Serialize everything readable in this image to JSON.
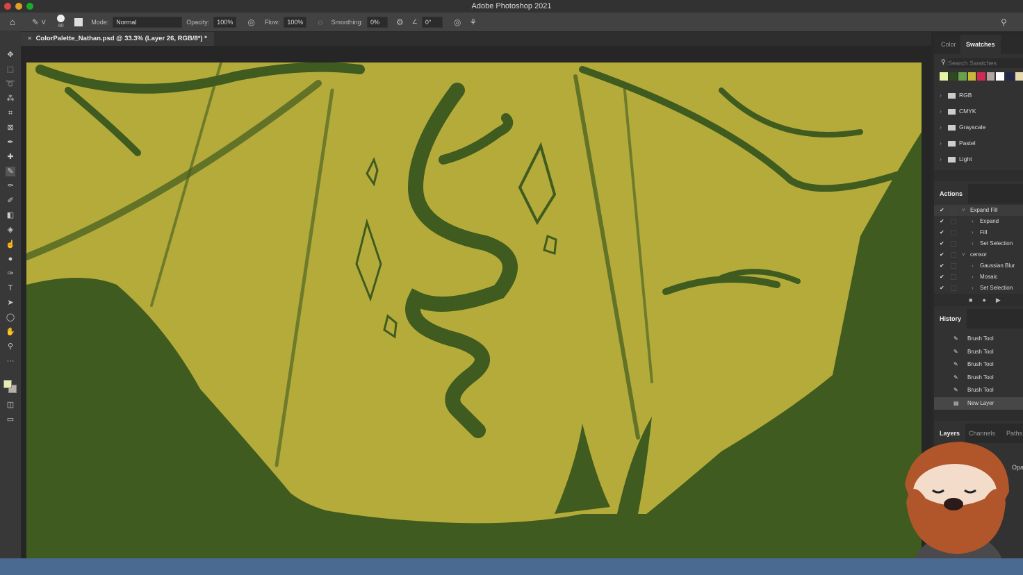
{
  "app_title": "Adobe Photoshop 2021",
  "options": {
    "brush_size": "80",
    "mode_label": "Mode:",
    "mode_value": "Normal",
    "opacity_label": "Opacity:",
    "opacity_value": "100%",
    "flow_label": "Flow:",
    "flow_value": "100%",
    "smoothing_label": "Smoothing:",
    "smoothing_value": "0%",
    "angle_value": "0°"
  },
  "document_tab": "ColorPalette_Nathan.psd @ 33.3% (Layer 26, RGB/8*) *",
  "swatches_panel": {
    "tabs": [
      "Color",
      "Swatches"
    ],
    "active_tab": "Swatches",
    "search_placeholder": "Search Swatches",
    "colors": [
      "#e4f5a4",
      "#2d4a1c",
      "#6aa04a",
      "#c8b83a",
      "#d02a52",
      "#b5a3a0",
      "#ffffff",
      "#262848",
      "#e8d8b0"
    ],
    "groups": [
      "RGB",
      "CMYK",
      "Grayscale",
      "Pastel",
      "Light"
    ]
  },
  "actions_panel": {
    "title": "Actions",
    "items": [
      {
        "label": "Expand Fill",
        "level": 0,
        "expanded": true
      },
      {
        "label": "Expand",
        "level": 1
      },
      {
        "label": "Fill",
        "level": 1
      },
      {
        "label": "Set Selection",
        "level": 1
      },
      {
        "label": "censor",
        "level": 0,
        "expanded": true
      },
      {
        "label": "Gaussian Blur",
        "level": 1
      },
      {
        "label": "Mosaic",
        "level": 1
      },
      {
        "label": "Set Selection",
        "level": 1
      }
    ]
  },
  "history_panel": {
    "title": "History",
    "items": [
      "Brush Tool",
      "Brush Tool",
      "Brush Tool",
      "Brush Tool",
      "Brush Tool",
      "New Layer"
    ]
  },
  "layers_panel": {
    "tabs": [
      "Layers",
      "Channels",
      "Paths"
    ],
    "active_tab": "Layers",
    "opacity_label": "Opa"
  },
  "colors": {
    "canvas_bg": "#b4ab3b",
    "ink": "#3f5b1f",
    "foreground": "#e4f0b0",
    "background": "#b8b0a8"
  }
}
